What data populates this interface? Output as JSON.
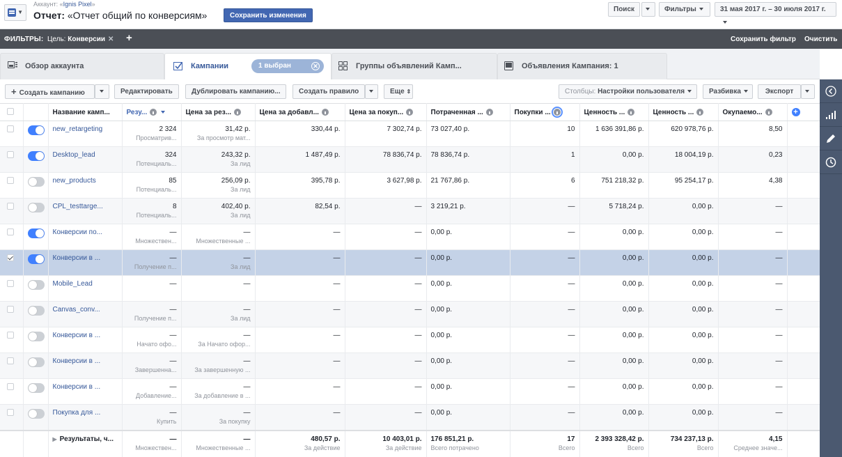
{
  "header": {
    "account_prefix": "Аккаунт: «",
    "account_name": "Ignis Pixel",
    "account_suffix": "»",
    "report_label": "Отчет:",
    "report_name": "«Отчет общий по конверсиям»",
    "save_changes": "Сохранить изменения",
    "search": "Поиск",
    "filters": "Фильтры",
    "date_range": "31 мая 2017 г. – 30 июля 2017 г."
  },
  "filterbar": {
    "label": "ФИЛЬТРЫ:",
    "chip_key": "Цель:",
    "chip_value": "Конверсии",
    "save_filter": "Сохранить фильтр",
    "clear": "Очистить"
  },
  "tabs": {
    "overview": "Обзор аккаунта",
    "campaigns": "Кампании",
    "selected": "1 выбран",
    "adsets": "Группы объявлений Камп...",
    "ads": "Объявления Кампания: 1"
  },
  "toolbar": {
    "create": "Создать кампанию",
    "edit": "Редактировать",
    "duplicate": "Дублировать кампанию...",
    "create_rule": "Создать правило",
    "more": "Еще",
    "columns_label": "Столбцы:",
    "columns_value": "Настройки пользователя",
    "breakdown": "Разбивка",
    "export": "Экспорт"
  },
  "columns": [
    "Название камп...",
    "Резу...",
    "Цена за рез...",
    "Цена за добавл...",
    "Цена за покуп...",
    "Потраченная ...",
    "Покупки ...",
    "Ценность ...",
    "Ценность ...",
    "Окупаемо..."
  ],
  "rows": [
    {
      "checked": false,
      "on": true,
      "name": "new_retargeting",
      "res": "2 324",
      "res_sub": "Просматрив...",
      "cpr": "31,42 р.",
      "cpr_sub": "За просмотр мат...",
      "cpa": "330,44 р.",
      "cpp": "7 302,74 р.",
      "spent": "73 027,40 р.",
      "purch": "10",
      "val1": "1 636 391,86 р.",
      "val2": "620 978,76 р.",
      "roas": "8,50"
    },
    {
      "checked": false,
      "on": true,
      "name": "Desktop_lead",
      "res": "324",
      "res_sub": "Потенциаль...",
      "cpr": "243,32 р.",
      "cpr_sub": "За лид",
      "cpa": "1 487,49 р.",
      "cpp": "78 836,74 р.",
      "spent": "78 836,74 р.",
      "purch": "1",
      "val1": "0,00 р.",
      "val2": "18 004,19 р.",
      "roas": "0,23"
    },
    {
      "checked": false,
      "on": false,
      "name": "new_products",
      "res": "85",
      "res_sub": "Потенциаль...",
      "cpr": "256,09 р.",
      "cpr_sub": "За лид",
      "cpa": "395,78 р.",
      "cpp": "3 627,98 р.",
      "spent": "21 767,86 р.",
      "purch": "6",
      "val1": "751 218,32 р.",
      "val2": "95 254,17 р.",
      "roas": "4,38"
    },
    {
      "checked": false,
      "on": false,
      "name": "CPL_testtarge...",
      "res": "8",
      "res_sub": "Потенциаль...",
      "cpr": "402,40 р.",
      "cpr_sub": "За лид",
      "cpa": "82,54 р.",
      "cpp": "—",
      "spent": "3 219,21 р.",
      "purch": "—",
      "val1": "5 718,24 р.",
      "val2": "0,00 р.",
      "roas": "—"
    },
    {
      "checked": false,
      "on": true,
      "name": "Конверсии по...",
      "res": "—",
      "res_sub": "Множествен...",
      "cpr": "—",
      "cpr_sub": "Множественные ...",
      "cpa": "—",
      "cpp": "—",
      "spent": "0,00 р.",
      "purch": "—",
      "val1": "0,00 р.",
      "val2": "0,00 р.",
      "roas": "—"
    },
    {
      "checked": true,
      "on": true,
      "name": "Конверсии в ...",
      "res": "—",
      "res_sub": "Получение п...",
      "cpr": "—",
      "cpr_sub": "За лид",
      "cpa": "—",
      "cpp": "—",
      "spent": "0,00 р.",
      "purch": "—",
      "val1": "0,00 р.",
      "val2": "0,00 р.",
      "roas": "—"
    },
    {
      "checked": false,
      "on": false,
      "name": "Mobile_Lead",
      "res": "—",
      "res_sub": "",
      "cpr": "—",
      "cpr_sub": "",
      "cpa": "—",
      "cpp": "—",
      "spent": "0,00 р.",
      "purch": "—",
      "val1": "0,00 р.",
      "val2": "0,00 р.",
      "roas": "—"
    },
    {
      "checked": false,
      "on": false,
      "name": "Canvas_conv...",
      "res": "—",
      "res_sub": "Получение п...",
      "cpr": "—",
      "cpr_sub": "За лид",
      "cpa": "—",
      "cpp": "—",
      "spent": "0,00 р.",
      "purch": "—",
      "val1": "0,00 р.",
      "val2": "0,00 р.",
      "roas": "—"
    },
    {
      "checked": false,
      "on": false,
      "name": "Конверсии в ...",
      "res": "—",
      "res_sub": "Начато офо...",
      "cpr": "—",
      "cpr_sub": "За Начато офор...",
      "cpa": "—",
      "cpp": "—",
      "spent": "0,00 р.",
      "purch": "—",
      "val1": "0,00 р.",
      "val2": "0,00 р.",
      "roas": "—"
    },
    {
      "checked": false,
      "on": false,
      "name": "Конверсии в ...",
      "res": "—",
      "res_sub": "Завершенна...",
      "cpr": "—",
      "cpr_sub": "За завершенную ...",
      "cpa": "—",
      "cpp": "—",
      "spent": "0,00 р.",
      "purch": "—",
      "val1": "0,00 р.",
      "val2": "0,00 р.",
      "roas": "—"
    },
    {
      "checked": false,
      "on": false,
      "name": "Конверсии в ...",
      "res": "—",
      "res_sub": "Добавление...",
      "cpr": "—",
      "cpr_sub": "За добавление в ...",
      "cpa": "—",
      "cpp": "—",
      "spent": "0,00 р.",
      "purch": "—",
      "val1": "0,00 р.",
      "val2": "0,00 р.",
      "roas": "—"
    },
    {
      "checked": false,
      "on": false,
      "name": "Покупка для ...",
      "res": "—",
      "res_sub": "Купить",
      "cpr": "—",
      "cpr_sub": "За покупку",
      "cpa": "—",
      "cpp": "—",
      "spent": "0,00 р.",
      "purch": "—",
      "val1": "0,00 р.",
      "val2": "0,00 р.",
      "roas": "—"
    }
  ],
  "totals": {
    "label": "Результаты, ч...",
    "res": "—",
    "res_sub": "Множествен...",
    "cpr": "—",
    "cpr_sub": "Множественные ...",
    "cpa": "480,57 р.",
    "cpa_sub": "За действие",
    "cpp": "10 403,01 р.",
    "cpp_sub": "За действие",
    "spent": "176 851,21 р.",
    "spent_sub": "Всего потрачено",
    "purch": "17",
    "purch_sub": "Всего",
    "val1": "2 393 328,42 р.",
    "val1_sub": "Всего",
    "val2": "734 237,13 р.",
    "val2_sub": "Всего",
    "roas": "4,15",
    "roas_sub": "Среднее значе..."
  }
}
